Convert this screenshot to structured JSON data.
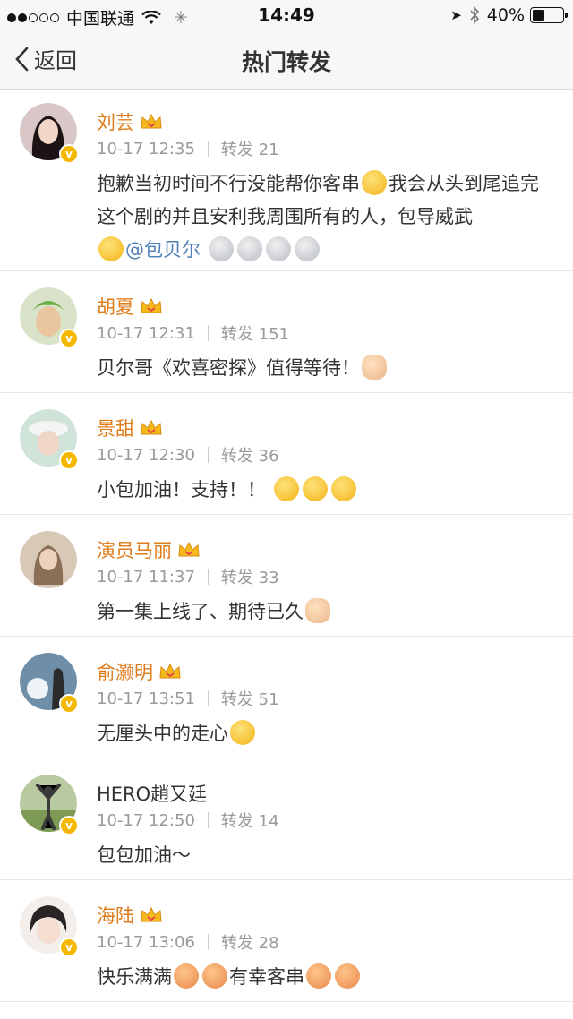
{
  "status_bar": {
    "carrier": "中国联通",
    "time": "14:49",
    "battery_percent": "40%",
    "battery_level": 0.4,
    "signal_bars_filled": 2,
    "signal_bars_total": 5
  },
  "nav": {
    "back_label": "返回",
    "title": "热门转发"
  },
  "colors": {
    "username": "#e07b1a",
    "meta": "#999999",
    "mention": "#4e7fb6",
    "verified_badge": "#f5b800"
  },
  "comments": [
    {
      "username": "刘芸",
      "crown": true,
      "time": "10-17 12:35",
      "repost": "转发 21",
      "text_parts": [
        "抱歉当初时间不行没能帮你客串",
        "我会从头到尾追完这个剧的并且安利我周围所有的人，包导威武",
        ""
      ],
      "mention": "@包贝尔",
      "emoji_icons": [
        "tongue-out-emoji",
        "cool-sunglasses-emoji",
        "ultraman-emoji",
        "ultraman-emoji",
        "ultraman-emoji",
        "ultraman-emoji"
      ]
    },
    {
      "username": "胡夏",
      "crown": true,
      "time": "10-17 12:31",
      "repost": "转发 151",
      "text": "贝尔哥《欢喜密探》值得等待！",
      "emoji_icons": [
        "thumbs-up-emoji"
      ]
    },
    {
      "username": "景甜",
      "crown": true,
      "time": "10-17 12:30",
      "repost": "转发 36",
      "text": "小包加油！支持！！",
      "emoji_icons": [
        "cheer-emoji",
        "cheer-emoji",
        "cheer-emoji"
      ]
    },
    {
      "username": "演员马丽",
      "crown": true,
      "time": "10-17 11:37",
      "repost": "转发 33",
      "text": "第一集上线了、期待已久",
      "emoji_icons": [
        "victory-hand-emoji"
      ]
    },
    {
      "username": "俞灏明",
      "crown": true,
      "time": "10-17 13:51",
      "repost": "转发 51",
      "text": "无厘头中的走心",
      "emoji_icons": [
        "grin-emoji"
      ]
    },
    {
      "username": "HERO趙又廷",
      "crown": false,
      "time": "10-17 12:50",
      "repost": "转发 14",
      "text": "包包加油～",
      "emoji_icons": []
    },
    {
      "username": "海陆",
      "crown": true,
      "time": "10-17 13:06",
      "repost": "转发 28",
      "text_parts": [
        "快乐满满",
        "有幸客串"
      ],
      "emoji_icons": [
        "pig-emoji",
        "pig-emoji",
        "pig-emoji",
        "pig-emoji"
      ]
    }
  ]
}
